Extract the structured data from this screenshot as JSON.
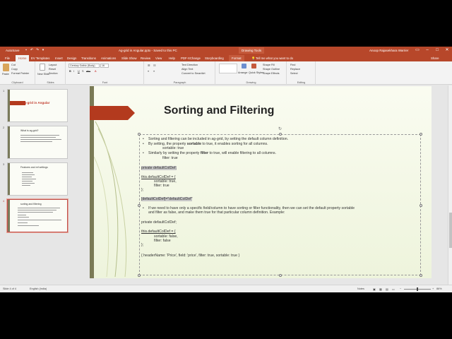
{
  "titlebar": {
    "autosave": "AutoSave",
    "doc_title": "Ag-grid in Angular.pptx - Saved to this PC",
    "context_label": "Drawing Tools",
    "user": "Anoop Rajasekhara Warrier"
  },
  "tabs": [
    {
      "label": "File"
    },
    {
      "label": "Home"
    },
    {
      "label": "EV Templates"
    },
    {
      "label": "Insert"
    },
    {
      "label": "Design"
    },
    {
      "label": "Transitions"
    },
    {
      "label": "Animations"
    },
    {
      "label": "Slide Show"
    },
    {
      "label": "Review"
    },
    {
      "label": "View"
    },
    {
      "label": "Help"
    },
    {
      "label": "PDF-XChange"
    },
    {
      "label": "Storyboarding"
    },
    {
      "label": "Format"
    }
  ],
  "tell_me": "Tell me what you want to do",
  "share": "Share",
  "ribbon": {
    "paste": "Paste",
    "cut": "Cut",
    "copy": "Copy",
    "format_painter": "Format Painter",
    "clipboard": "Clipboard",
    "new_slide": "New Slide",
    "layout": "Layout",
    "reset": "Reset",
    "section": "Section",
    "slides": "Slides",
    "font_name": "Century Gothic (Body)",
    "font_size": "16",
    "font": "Font",
    "text_direction": "Text Direction",
    "align_text": "Align Text",
    "convert_smartart": "Convert to SmartArt",
    "paragraph": "Paragraph",
    "arrange": "Arrange",
    "quick_styles": "Quick Styles",
    "drawing": "Drawing",
    "shape_fill": "Shape Fill",
    "shape_outline": "Shape Outline",
    "shape_effects": "Shape Effects",
    "find": "Find",
    "replace": "Replace",
    "select": "Select",
    "editing": "Editing"
  },
  "thumbnails": [
    {
      "num": "1",
      "title": "Ag-grid in Angular"
    },
    {
      "num": "2",
      "title": "What is ag-grid?"
    },
    {
      "num": "3",
      "title": "Features and ref settings"
    },
    {
      "num": "4",
      "title": "sorting and filtering"
    }
  ],
  "slide": {
    "title": "Sorting and Filtering",
    "b1": "Sorting and filtering can be included in ag-grid, by setting the default column definition.",
    "b2_pre": "By setting, the property ",
    "b2_bold": "sortable",
    "b2_post": " to true, it enables sorting for all columns.",
    "b2_sub": "sortable: true",
    "b3_pre": "Similarly by setting the property ",
    "b3_bold": "filter",
    "b3_post": " to true, will enable filtering to all columns.",
    "b3_sub": "filter: true",
    "code1": "private defaultColDef;",
    "code2": "this.defaultColDef = {",
    "code3": "sortable: true,",
    "code4": "filter: true",
    "code5": "};",
    "code6": "[defaultColDef]=\"defaultColDef\"",
    "b4_line1": "If we need to have only a specific field/column to have sorting or filter functionality, then we can set the default property sortable",
    "b4_line2": "and filter as false, and make them true for that particular column definition. Example:",
    "code7": "private defaultColDef;",
    "code8": "this.defaultColDef = {",
    "code9": "sortable: false,",
    "code10": "filter: false",
    "code11": "};",
    "code12": "{ headerName: 'Price', field: 'price', filter: true, sortable: true }"
  },
  "status": {
    "slide_of": "Slide 4 of 4",
    "language": "English (India)",
    "notes": "Notes",
    "zoom": "86%"
  }
}
